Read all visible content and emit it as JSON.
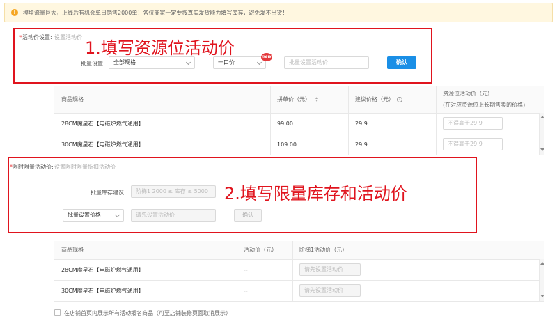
{
  "notice": {
    "icon": "info-icon",
    "text": "模块流量巨大，上线后有机会单日销售2000单！各位商家一定要按真实发货能力填写库存，避免发不出货！"
  },
  "section1": {
    "label_req": "*",
    "label": "活动价设置:",
    "hint": "设置活动价",
    "batch_label": "批量设置",
    "spec_select": "全部规格",
    "price_type_select": "一口价",
    "new_badge": "new",
    "price_input_placeholder": "批量设置活动价",
    "confirm_button": "确认"
  },
  "annotation1": "1.填写资源位活动价",
  "annotation2": "2.填写限量库存和活动价",
  "table1": {
    "headers": [
      "商品规格",
      "拼单价（元）",
      "建议价格（元）",
      "资源位活动价（元）",
      "(在对应资源位上长期售卖的价格)"
    ],
    "rows": [
      {
        "spec": "28CM魔星石【电磁炉燃气通用】",
        "group_price": "99.00",
        "suggested": "29.9",
        "placeholder": "不得高于29.9"
      },
      {
        "spec": "30CM魔星石【电磁炉燃气通用】",
        "group_price": "109.00",
        "suggested": "29.9",
        "placeholder": "不得高于29.9"
      }
    ]
  },
  "section2": {
    "label_req": "*",
    "label": "限时限量活动价:",
    "hint": "设置限时限量折扣活动价",
    "stock_label": "批量库存建议",
    "stock_placeholder": "阶梯1 2000 ≤ 库存 ≤ 5000",
    "batch_select": "批量设置价格",
    "price_placeholder": "请先设置活动价",
    "confirm_button": "确认"
  },
  "table2": {
    "headers": [
      "商品规格",
      "活动价（元）",
      "阶梯1活动价（元）"
    ],
    "rows": [
      {
        "spec": "28CM魔星石【电磁炉燃气通用】",
        "price": "--",
        "placeholder": "请先设置活动价"
      },
      {
        "spec": "30CM魔星石【电磁炉燃气通用】",
        "price": "--",
        "placeholder": "请先设置活动价"
      }
    ]
  },
  "footer": {
    "checkbox_label": "在店铺首页内展示所有活动报名商品（可至店铺装修页面取消展示）"
  },
  "colors": {
    "accent": "#1a8fe6",
    "annotation": "#e0141e",
    "notice_bg": "#fff7e0"
  }
}
